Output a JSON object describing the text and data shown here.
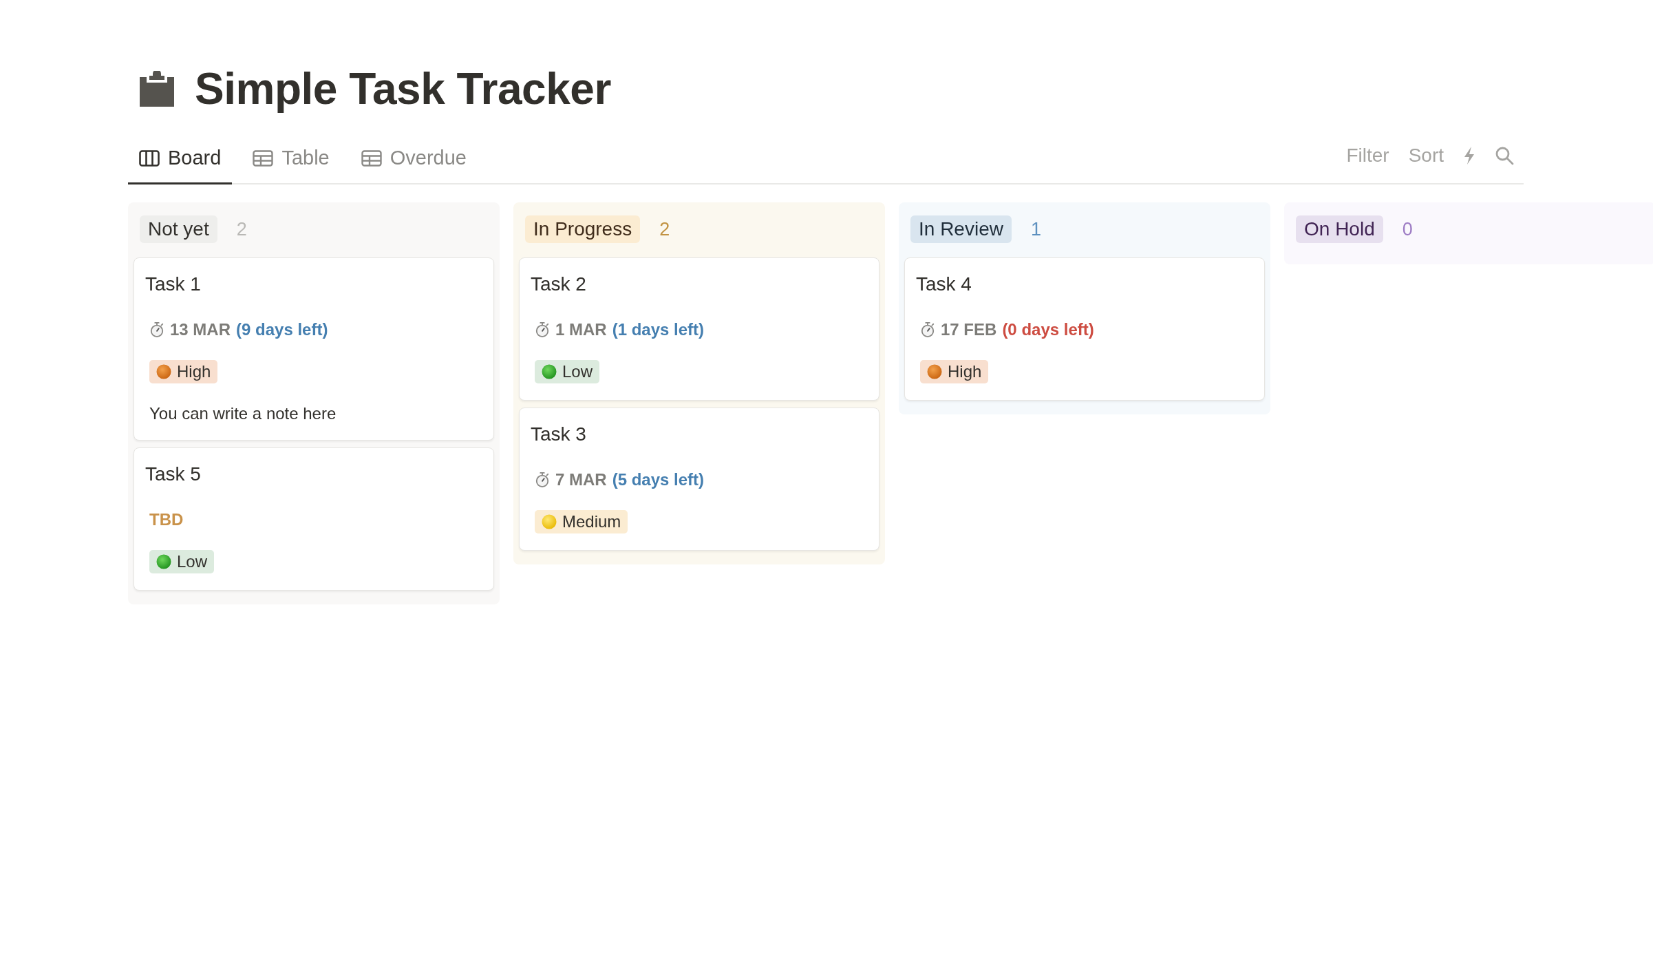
{
  "page": {
    "title": "Simple Task Tracker"
  },
  "tabs": [
    {
      "label": "Board",
      "kind": "board",
      "selected": true
    },
    {
      "label": "Table",
      "kind": "table",
      "selected": false
    },
    {
      "label": "Overdue",
      "kind": "table",
      "selected": false
    }
  ],
  "toolbar": {
    "filter": "Filter",
    "sort": "Sort"
  },
  "columns": [
    {
      "name": "Not yet",
      "count": "2",
      "color": "#eeeeec",
      "cards": [
        {
          "title": "Task 1",
          "due": {
            "date": "13 MAR",
            "left": "(9 days left)",
            "overdue": false
          },
          "priority": {
            "label": "High",
            "kind": "high"
          },
          "note": "You can write a note here"
        },
        {
          "title": "Task 5",
          "pending": "TBD",
          "priority": {
            "label": "Low",
            "kind": "low"
          }
        }
      ]
    },
    {
      "name": "In Progress",
      "count": "2",
      "color": "#fbecd2",
      "cards": [
        {
          "title": "Task 2",
          "due": {
            "date": "1 MAR",
            "left": "(1 days left)",
            "overdue": false
          },
          "priority": {
            "label": "Low",
            "kind": "low"
          }
        },
        {
          "title": "Task 3",
          "due": {
            "date": "7 MAR",
            "left": "(5 days left)",
            "overdue": false
          },
          "priority": {
            "label": "Medium",
            "kind": "medium"
          }
        }
      ]
    },
    {
      "name": "In Review",
      "count": "1",
      "color": "#d9e5ef",
      "cards": [
        {
          "title": "Task 4",
          "due": {
            "date": "17 FEB",
            "left": "(0 days left)",
            "overdue": true
          },
          "priority": {
            "label": "High",
            "kind": "high"
          }
        }
      ]
    },
    {
      "name": "On Hold",
      "count": "0",
      "color": "#e7e0ef"
    }
  ]
}
